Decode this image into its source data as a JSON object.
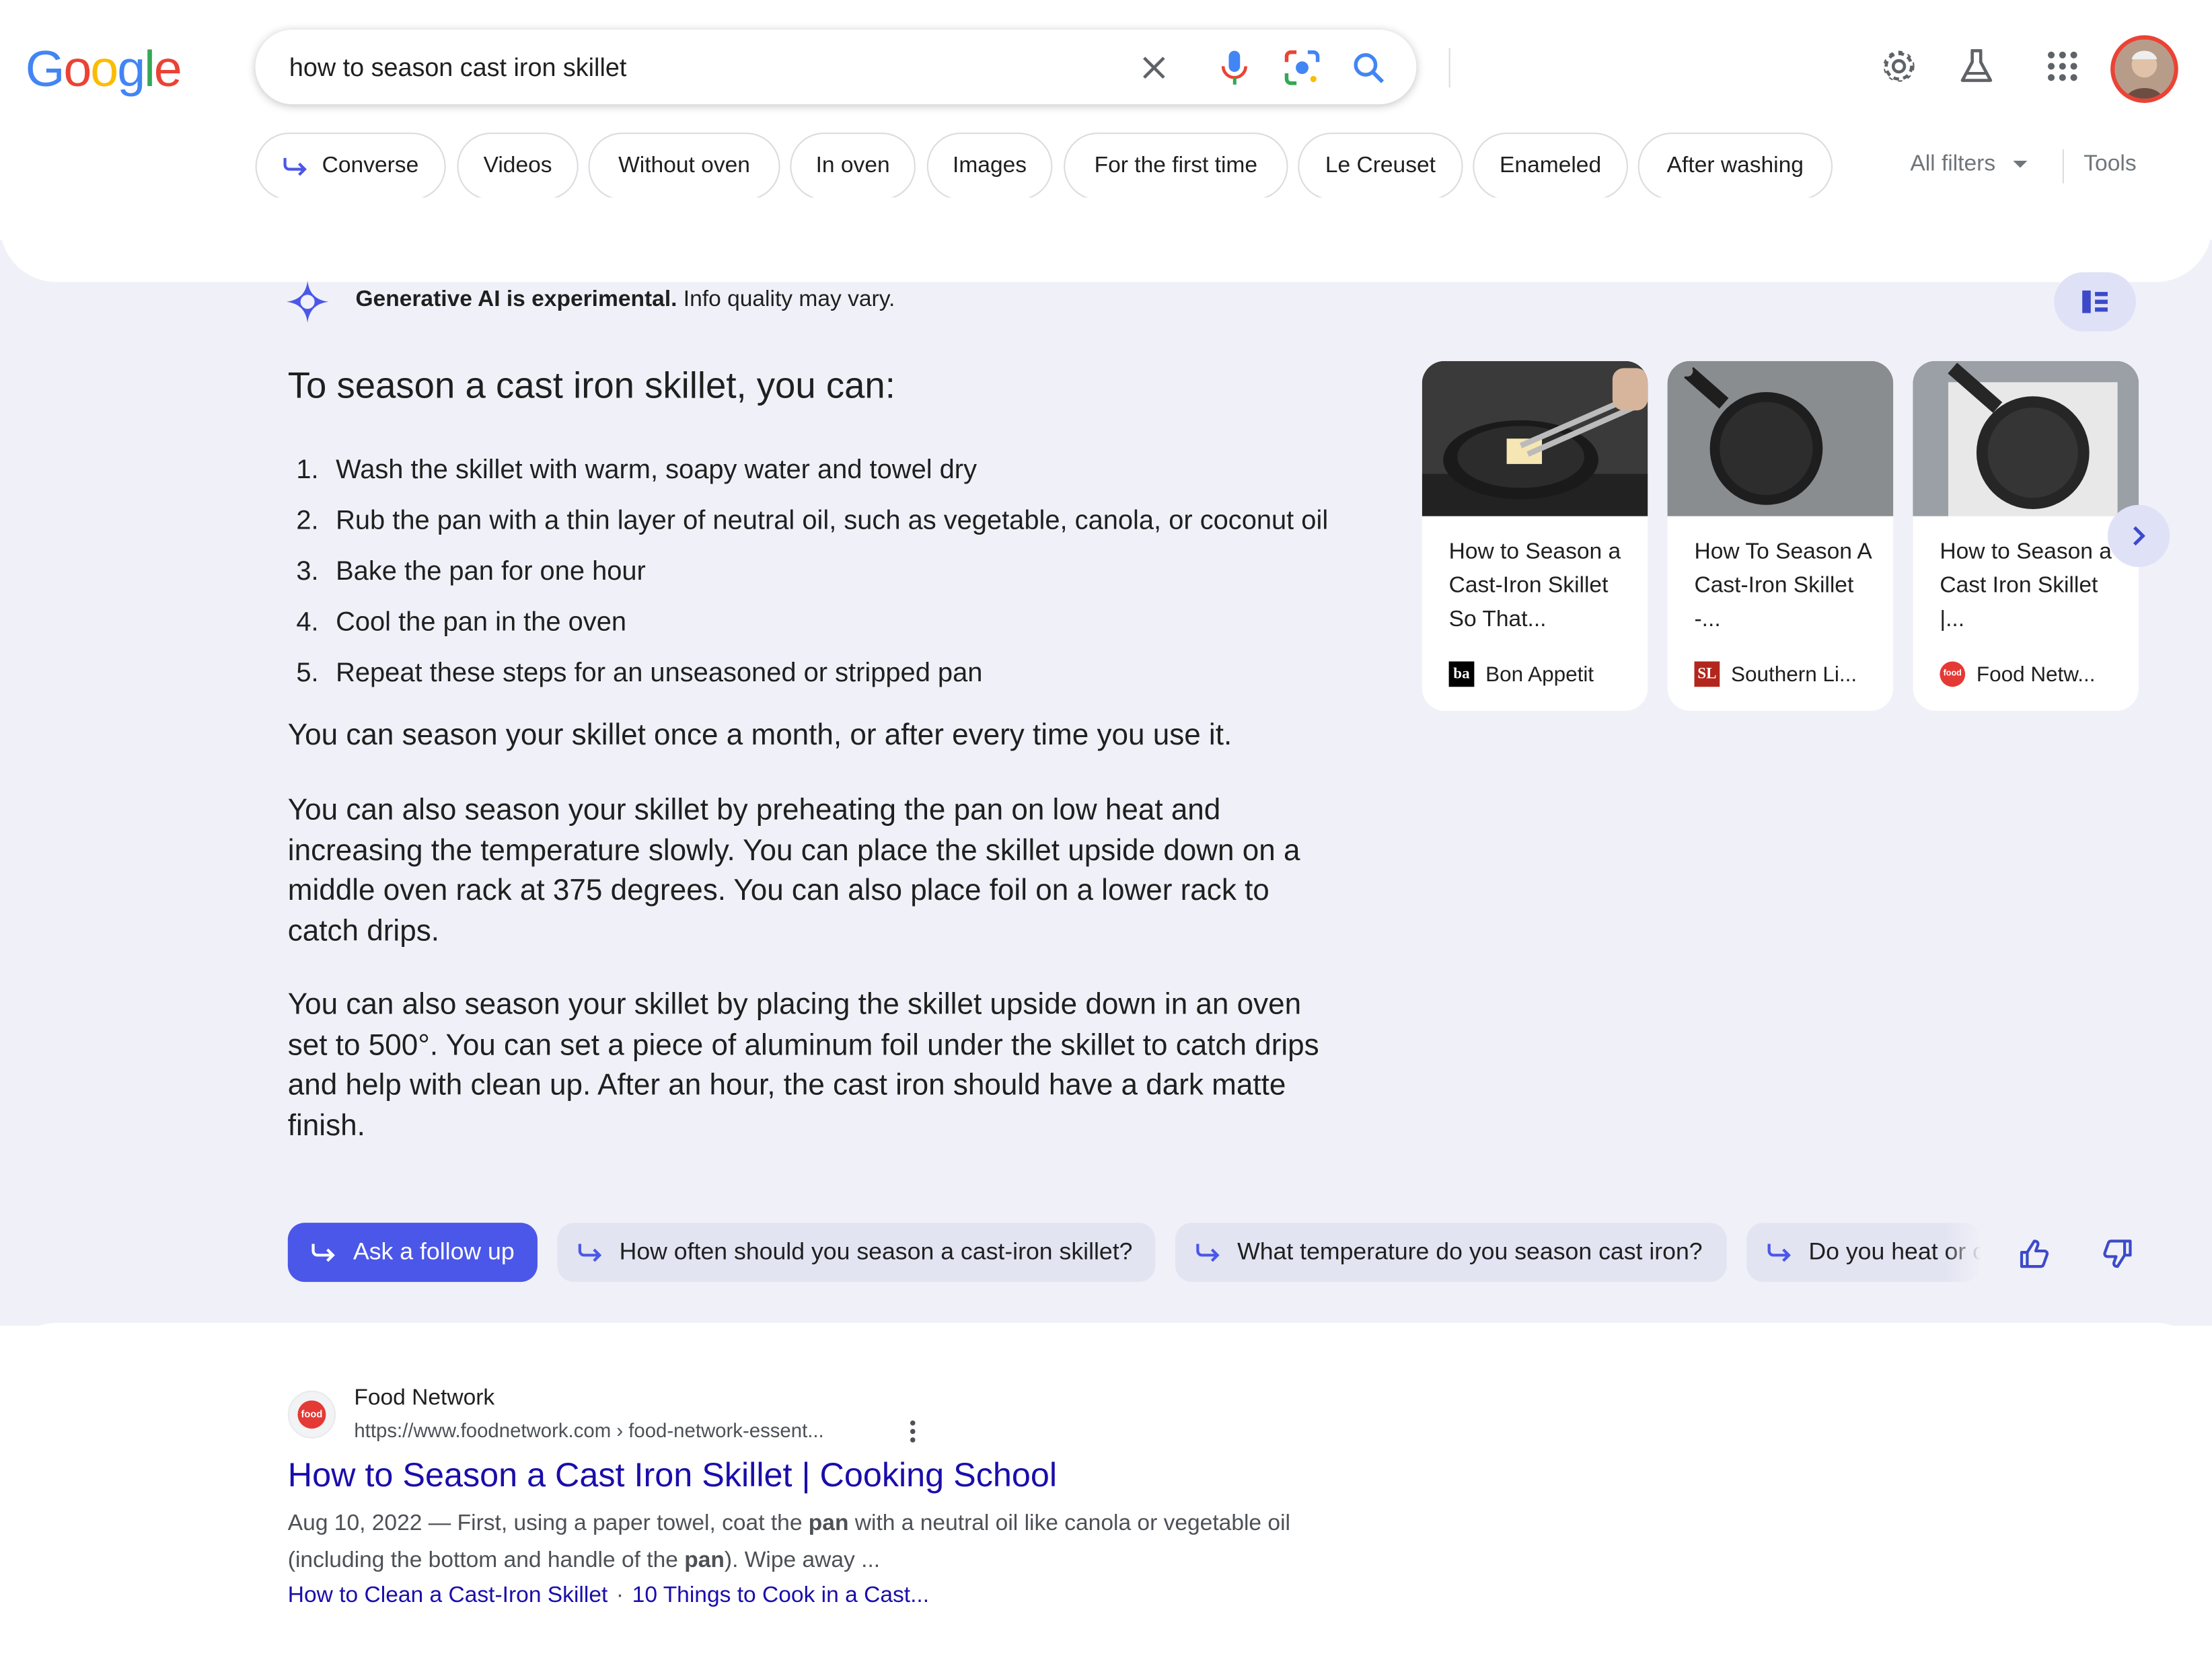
{
  "header": {
    "logo": "Google",
    "search_value": "how to season cast iron skillet"
  },
  "chips": [
    "Converse",
    "Videos",
    "Without oven",
    "In oven",
    "Images",
    "For the first time",
    "Le Creuset",
    "Enameled",
    "After washing"
  ],
  "filters": {
    "all_filters": "All filters",
    "tools": "Tools"
  },
  "ai": {
    "experimental_bold": "Generative AI is experimental.",
    "experimental_rest": " Info quality may vary.",
    "title": "To season a cast iron skillet, you can:",
    "steps": [
      {
        "n": "1.",
        "text": "Wash the skillet with warm, soapy water and towel dry"
      },
      {
        "n": "2.",
        "text": "Rub the pan with a thin layer of neutral oil, such as vegetable, canola, or coconut oil"
      },
      {
        "n": "3.",
        "text": "Bake the pan for one hour"
      },
      {
        "n": "4.",
        "text": "Cool the pan in the oven"
      },
      {
        "n": "5.",
        "text": "Repeat these steps for an unseasoned or stripped pan"
      }
    ],
    "para1": "You can season your skillet once a month, or after every time you use it.",
    "para2": "You can also season your skillet by preheating the pan on low heat and increasing the temperature slowly. You can place the skillet upside down on a middle oven rack at 375 degrees. You can also place foil on a lower rack to catch drips.",
    "para3": "You can also season your skillet by placing the skillet upside down in an oven set to 500°. You can set a piece of aluminum foil under the skillet to catch drips and help with clean up. After an hour, the cast iron should have a dark matte finish.",
    "cards": [
      {
        "title": "How to Season a Cast-Iron Skillet So That...",
        "source": "Bon Appetit",
        "fav": "ba"
      },
      {
        "title": "How To Season A Cast-Iron Skillet -...",
        "source": "Southern Li...",
        "fav": "SL"
      },
      {
        "title": "How to Season a Cast Iron Skillet |...",
        "source": "Food Netw...",
        "fav": "food"
      }
    ],
    "ask_follow_up": "Ask a follow up",
    "follow_ups": [
      "How often should you season a cast-iron skillet?",
      "What temperature do you season cast iron?",
      "Do you heat or oil cast iron first?"
    ]
  },
  "result": {
    "site": "Food Network",
    "url": "https://www.foodnetwork.com › food-network-essent...",
    "fav": "food",
    "title": "How to Season a Cast Iron Skillet | Cooking School",
    "date": "Aug 10, 2022",
    "snippet_a": " — First, using a paper towel, coat the ",
    "snippet_b1": "pan",
    "snippet_c": " with a neutral oil like canola or vegetable oil (including the bottom and handle of the ",
    "snippet_b2": "pan",
    "snippet_d": "). Wipe away ...",
    "sitelink1": "How to Clean a Cast-Iron Skillet",
    "sitelink_sep": "·",
    "sitelink2": "10 Things to Cook in a Cast..."
  },
  "colors": {
    "accent": "#4b57e8",
    "link": "#1a0dab",
    "panel_bg": "#f0f0f8"
  }
}
